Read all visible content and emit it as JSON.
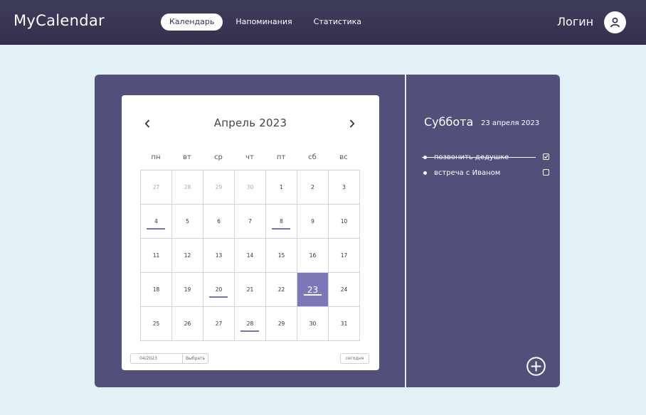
{
  "app": {
    "title": "MyCalendar"
  },
  "nav": {
    "items": [
      {
        "label": "Календарь",
        "active": true
      },
      {
        "label": "Напоминания",
        "active": false
      },
      {
        "label": "Статистика",
        "active": false
      }
    ]
  },
  "user": {
    "login_label": "Логин",
    "avatar_icon": "user-icon"
  },
  "calendar": {
    "month_title": "Апрель 2023",
    "prev_icon": "chevron-left-icon",
    "next_icon": "chevron-right-icon",
    "weekdays": [
      "пн",
      "вт",
      "ср",
      "чт",
      "пт",
      "сб",
      "вс"
    ],
    "weeks": [
      [
        {
          "n": "27",
          "other": true
        },
        {
          "n": "28",
          "other": true
        },
        {
          "n": "29",
          "other": true
        },
        {
          "n": "30",
          "other": true
        },
        {
          "n": "1"
        },
        {
          "n": "2"
        },
        {
          "n": "3"
        }
      ],
      [
        {
          "n": "4",
          "mark": true
        },
        {
          "n": "5"
        },
        {
          "n": "6"
        },
        {
          "n": "7"
        },
        {
          "n": "8",
          "mark": true
        },
        {
          "n": "9"
        },
        {
          "n": "10"
        }
      ],
      [
        {
          "n": "11"
        },
        {
          "n": "12"
        },
        {
          "n": "13"
        },
        {
          "n": "14"
        },
        {
          "n": "15"
        },
        {
          "n": "16"
        },
        {
          "n": "17"
        }
      ],
      [
        {
          "n": "18"
        },
        {
          "n": "19"
        },
        {
          "n": "20",
          "mark": true
        },
        {
          "n": "21"
        },
        {
          "n": "22"
        },
        {
          "n": "23",
          "mark": true,
          "selected": true
        },
        {
          "n": "24"
        }
      ],
      [
        {
          "n": "25"
        },
        {
          "n": "26"
        },
        {
          "n": "27"
        },
        {
          "n": "28",
          "mark": true
        },
        {
          "n": "29"
        },
        {
          "n": "30"
        },
        {
          "n": "31"
        }
      ]
    ],
    "month_input_value": "04/2023",
    "pick_label": "Выбрать",
    "today_label": "сегодня"
  },
  "day_detail": {
    "day_name": "Суббота",
    "date": "23 апреля 2023",
    "tasks": [
      {
        "text": "позвонить дедушке",
        "done": true
      },
      {
        "text": "встреча с Иваном",
        "done": false
      }
    ],
    "add_icon": "plus-circle-icon"
  },
  "colors": {
    "header": "#3a3756",
    "background": "#e2f1f5",
    "panel": "#524f7a",
    "selected_day": "#7c78b8",
    "event_mark": "#7b6fb3"
  }
}
